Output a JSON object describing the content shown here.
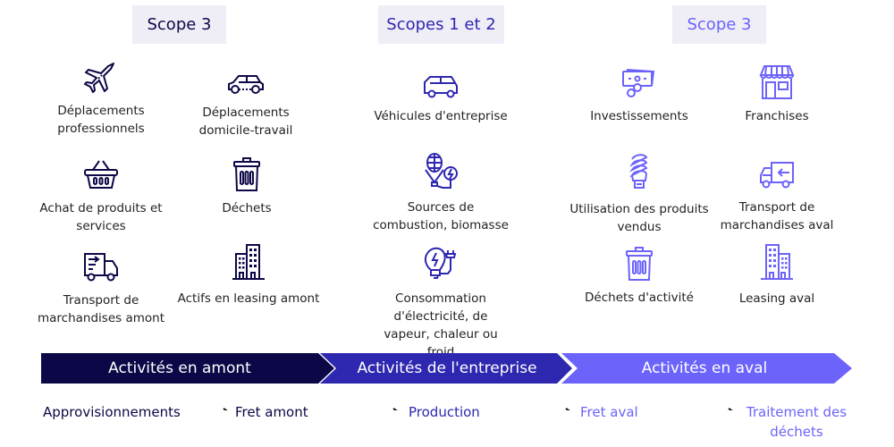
{
  "colors": {
    "navy": "#0c0847",
    "blue": "#2e27b0",
    "violet": "#6c63fb",
    "badge_bg": "#efeef7"
  },
  "columns": [
    {
      "scope_label": "Scope 3",
      "items": [
        {
          "icon": "airplane-icon",
          "label": "Déplacements professionnels"
        },
        {
          "icon": "car-icon",
          "label": "Déplacements domicile-travail"
        },
        {
          "icon": "basket-icon",
          "label": "Achat de produits et services"
        },
        {
          "icon": "trash-icon",
          "label": "Déchets"
        },
        {
          "icon": "delivery-truck-icon",
          "label": "Transport de marchandises amont"
        },
        {
          "icon": "buildings-icon",
          "label": "Actifs en leasing amont"
        }
      ]
    },
    {
      "scope_label": "Scopes 1 et 2",
      "items": [
        {
          "icon": "company-van-icon",
          "label": "Véhicules d'entreprise"
        },
        {
          "icon": "biomass-energy-icon",
          "label": "Sources de combustion, biomasse"
        },
        {
          "icon": "electric-bulb-plug-icon",
          "label": "Consommation d'électricité, de vapeur, chaleur ou froid"
        }
      ]
    },
    {
      "scope_label": "Scope 3",
      "items": [
        {
          "icon": "money-icon",
          "label": "Investissements"
        },
        {
          "icon": "storefront-icon",
          "label": "Franchises"
        },
        {
          "icon": "lightbulb-icon",
          "label": "Utilisation des produits vendus"
        },
        {
          "icon": "return-truck-icon",
          "label": "Transport de marchandises aval"
        },
        {
          "icon": "trash-icon",
          "label": "Déchets d'activité"
        },
        {
          "icon": "buildings-icon",
          "label": "Leasing aval"
        }
      ]
    }
  ],
  "phases": [
    "Activités en amont",
    "Activités de l'entreprise",
    "Activités en aval"
  ],
  "flow": [
    "Approvisionnements",
    "Fret amont",
    "Production",
    "Fret aval",
    "Traitement des déchets"
  ]
}
